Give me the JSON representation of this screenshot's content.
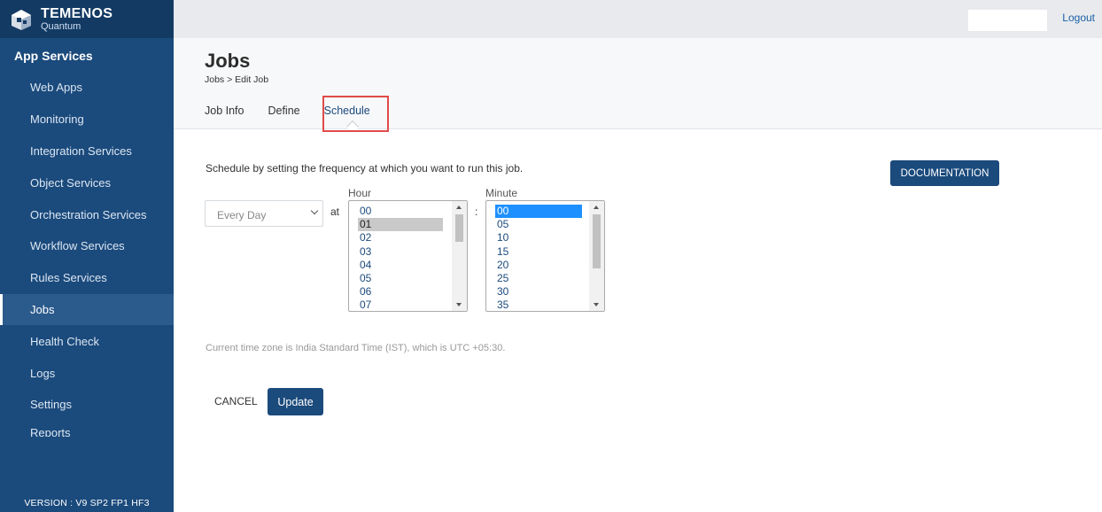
{
  "brand": {
    "name": "TEMENOS",
    "product": "Quantum"
  },
  "sidebar": {
    "section_title": "App Services",
    "items": [
      {
        "label": "Web Apps"
      },
      {
        "label": "Monitoring"
      },
      {
        "label": "Integration Services"
      },
      {
        "label": "Object Services"
      },
      {
        "label": "Orchestration Services"
      },
      {
        "label": "Workflow Services"
      },
      {
        "label": "Rules Services"
      },
      {
        "label": "Jobs",
        "active": true
      },
      {
        "label": "Health Check"
      },
      {
        "label": "Logs"
      },
      {
        "label": "Settings"
      },
      {
        "label": "Reports"
      }
    ],
    "version": "VERSION : V9 SP2 FP1 HF3"
  },
  "topbar": {
    "logout_label": "Logout"
  },
  "page": {
    "title": "Jobs",
    "breadcrumb": "Jobs > Edit Job",
    "tabs": [
      {
        "label": "Job Info"
      },
      {
        "label": "Define"
      },
      {
        "label": "Schedule",
        "active": true
      }
    ]
  },
  "schedule": {
    "intro": "Schedule by setting the frequency at which you want to run this job.",
    "documentation_label": "DOCUMENTATION",
    "frequency_value": "Every Day",
    "at_label": "at",
    "colon": ":",
    "hour_label": "Hour",
    "minute_label": "Minute",
    "hour_options": [
      "00",
      "01",
      "02",
      "03",
      "04",
      "05",
      "06",
      "07"
    ],
    "hour_selected": "01",
    "minute_options": [
      "00",
      "05",
      "10",
      "15",
      "20",
      "25",
      "30",
      "35"
    ],
    "minute_selected": "00",
    "timezone_note": "Current time zone is India Standard Time (IST), which is UTC +05:30.",
    "cancel_label": "CANCEL",
    "update_label": "Update"
  },
  "colors": {
    "sidebar": "#1b4a7c",
    "accent": "#1b4a7c",
    "highlight": "#e04a4a",
    "selection_blue": "#1e90ff"
  },
  "icons": [
    "temenos-logo-icon",
    "chevron-down-icon",
    "scroll-up-icon",
    "scroll-down-icon"
  ]
}
